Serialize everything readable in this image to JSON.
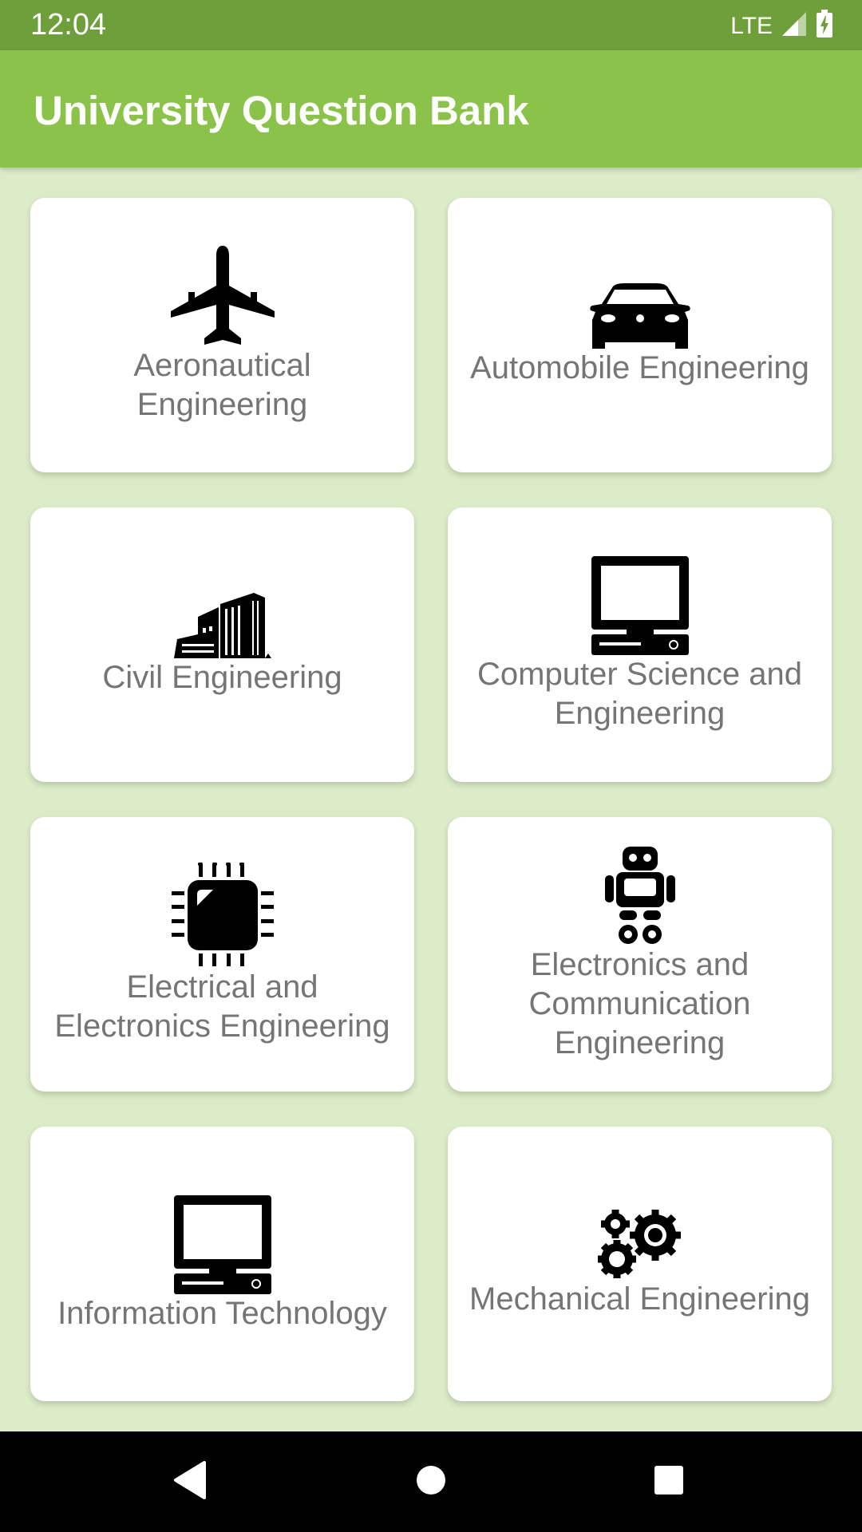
{
  "status_bar": {
    "time": "12:04",
    "network": "LTE"
  },
  "app_bar": {
    "title": "University Question Bank"
  },
  "departments": [
    {
      "label": "Aeronautical Engineering",
      "icon": "airplane-icon"
    },
    {
      "label": "Automobile Engineering",
      "icon": "car-icon"
    },
    {
      "label": "Civil Engineering",
      "icon": "buildings-icon"
    },
    {
      "label": "Computer Science and Engineering",
      "icon": "desktop-computer-icon"
    },
    {
      "label": "Electrical and Electronics Engineering",
      "icon": "microchip-icon"
    },
    {
      "label": "Electronics and Communication Engineering",
      "icon": "robot-icon"
    },
    {
      "label": "Information Technology",
      "icon": "desktop-computer-icon"
    },
    {
      "label": "Mechanical Engineering",
      "icon": "gears-icon"
    }
  ],
  "nav_bar": {
    "buttons": [
      "back-icon",
      "home-icon",
      "recents-icon"
    ]
  },
  "colors": {
    "status_bar": "#6e9f3b",
    "app_bar": "#8bc34a",
    "background": "#dcecc8",
    "card": "#ffffff",
    "label_text": "#757575"
  }
}
